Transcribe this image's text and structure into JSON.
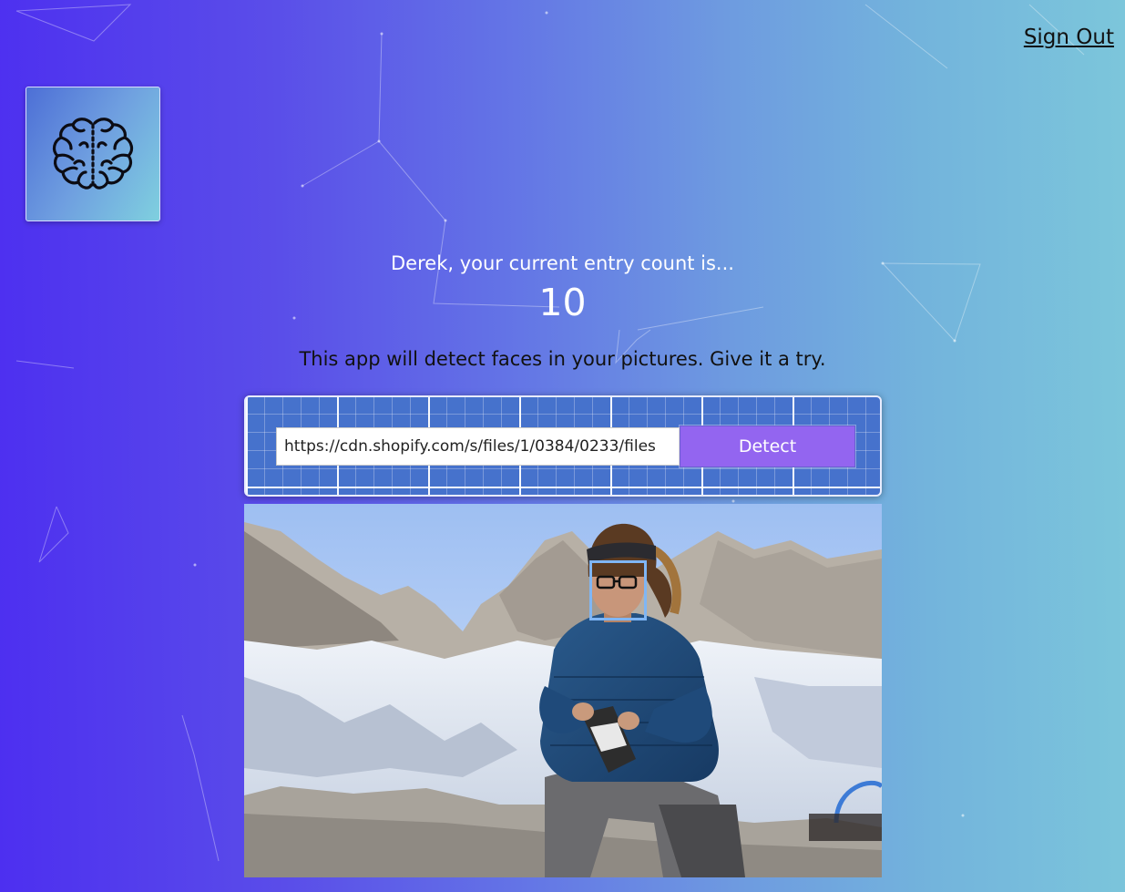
{
  "header": {
    "sign_out_label": "Sign Out"
  },
  "logo": {
    "icon": "brain-icon"
  },
  "rank": {
    "greeting": "Derek, your current entry count is...",
    "count": "10"
  },
  "intro": {
    "description": "This app will detect faces in your pictures. Give it a try."
  },
  "form": {
    "url_value": "https://cdn.shopify.com/s/files/1/0384/0233/files",
    "button_label": "Detect"
  },
  "result": {
    "image": "detected-photo",
    "face_count": 1
  },
  "colors": {
    "background_start": "#4d2ff0",
    "background_end": "#7cc6db",
    "button": "#9365f0",
    "face_box": "#7fb6f5"
  }
}
